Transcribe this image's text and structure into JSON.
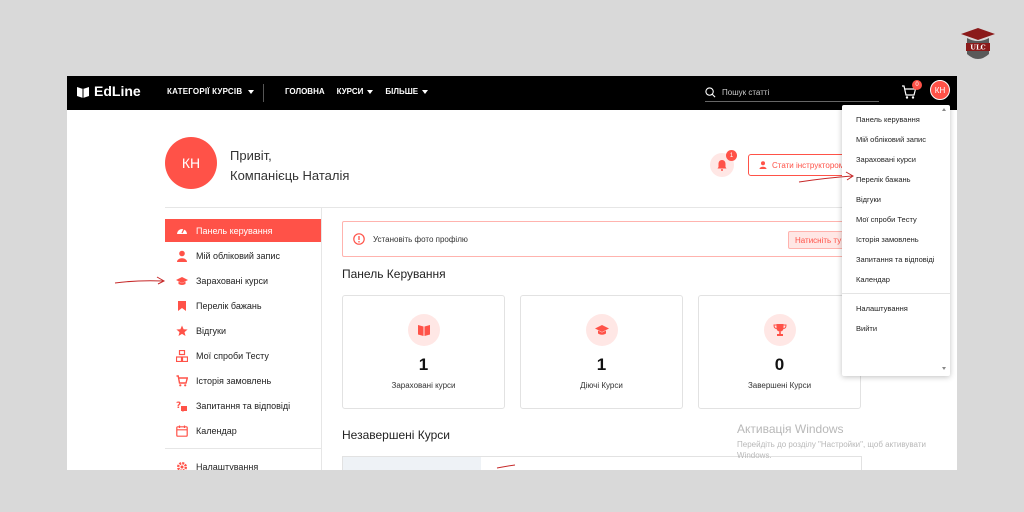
{
  "brand": {
    "logo_text": "ULC",
    "app_name": "EdLine",
    "accent": "#ff5248"
  },
  "nav": {
    "categories": "КАТЕГОРІЇ КУРСІВ",
    "links": [
      "ГОЛОВНА",
      "КУРСИ",
      "БІЛЬШЕ"
    ],
    "search_placeholder": "Пошук статті",
    "cart_count": "0",
    "avatar_initials": "КН"
  },
  "user": {
    "initials": "КН",
    "greeting": "Привіт,",
    "name": "Компанієць Наталія",
    "notifications": "1",
    "instructor_button": "Стати інструктором"
  },
  "sidebar": {
    "items": [
      {
        "label": "Панель керування",
        "icon": "dashboard-icon"
      },
      {
        "label": "Мій обліковий запис",
        "icon": "user-icon"
      },
      {
        "label": "Зараховані курси",
        "icon": "graduation-cap-icon"
      },
      {
        "label": "Перелік бажань",
        "icon": "bookmark-icon"
      },
      {
        "label": "Відгуки",
        "icon": "star-icon"
      },
      {
        "label": "Мої спроби Тесту",
        "icon": "quiz-icon"
      },
      {
        "label": "Історія замовлень",
        "icon": "cart-icon"
      },
      {
        "label": "Запитання та відповіді",
        "icon": "question-icon"
      },
      {
        "label": "Календар",
        "icon": "calendar-icon"
      }
    ],
    "settings": "Налаштування"
  },
  "alert": {
    "text": "Установіть фото профілю",
    "button": "Натисніть ту"
  },
  "dashboard": {
    "title": "Панель Керування",
    "cards": [
      {
        "value": "1",
        "label": "Зараховані курси",
        "icon": "book-icon"
      },
      {
        "value": "1",
        "label": "Діючі Курси",
        "icon": "graduation-cap-icon"
      },
      {
        "value": "0",
        "label": "Завершені Курси",
        "icon": "trophy-icon"
      }
    ],
    "unfinished_title": "Незавершені Курси"
  },
  "watermark": {
    "title": "Активація Windows",
    "subtitle": "Перейдіть до розділу \"Настройки\", щоб активувати Windows."
  },
  "dropdown": {
    "items": [
      "Панель керування",
      "Мій обліковий запис",
      "Зараховані курси",
      "Перелік бажань",
      "Відгуки",
      "Мої спроби Тесту",
      "Історія замовлень",
      "Запитання та відповіді",
      "Календар"
    ],
    "footer_items": [
      "Налаштування",
      "Вийти"
    ]
  }
}
